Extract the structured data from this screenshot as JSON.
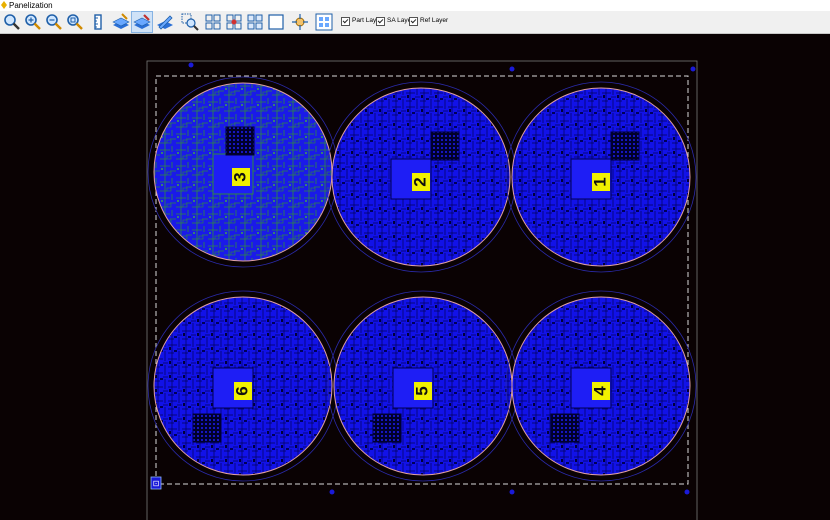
{
  "window": {
    "title": "Panelization"
  },
  "toolbar": {
    "buttons": [
      {
        "icon": "zoom-icon"
      },
      {
        "icon": "zoom-in-icon"
      },
      {
        "icon": "zoom-out-icon"
      },
      {
        "icon": "zoom-fit-icon"
      },
      {
        "icon": "ruler-icon"
      },
      {
        "icon": "layer-select-icon"
      },
      {
        "icon": "layer-edit-icon"
      },
      {
        "icon": "layer-pen-icon"
      },
      {
        "icon": "zoom-area-icon"
      },
      {
        "icon": "grid-zoom-icon"
      },
      {
        "icon": "grid-center-icon"
      },
      {
        "icon": "grid-icon"
      },
      {
        "icon": "frame-icon"
      },
      {
        "icon": "target-icon"
      },
      {
        "icon": "panel-icon"
      }
    ],
    "checkboxes": [
      {
        "label": "Part Layer",
        "checked": true
      },
      {
        "label": "SA Layer",
        "checked": true
      },
      {
        "label": "Ref Layer",
        "checked": true
      }
    ]
  },
  "panel": {
    "boards": [
      {
        "label": "3",
        "selected": true
      },
      {
        "label": "2",
        "selected": false
      },
      {
        "label": "1",
        "selected": false
      },
      {
        "label": "6",
        "selected": false
      },
      {
        "label": "5",
        "selected": false
      },
      {
        "label": "4",
        "selected": false
      }
    ],
    "origin_marker": "⊡",
    "colors": {
      "canvas_bg": "#0a0203",
      "board_fill": "#1212e8",
      "board_outline": "#e0a0a0",
      "trace_dark": "#000050",
      "trace_green": "#2e8b3d",
      "label_bg": "#f0f000",
      "frame": "#d8d8d8",
      "route_outline": "#2a2aa8"
    }
  }
}
